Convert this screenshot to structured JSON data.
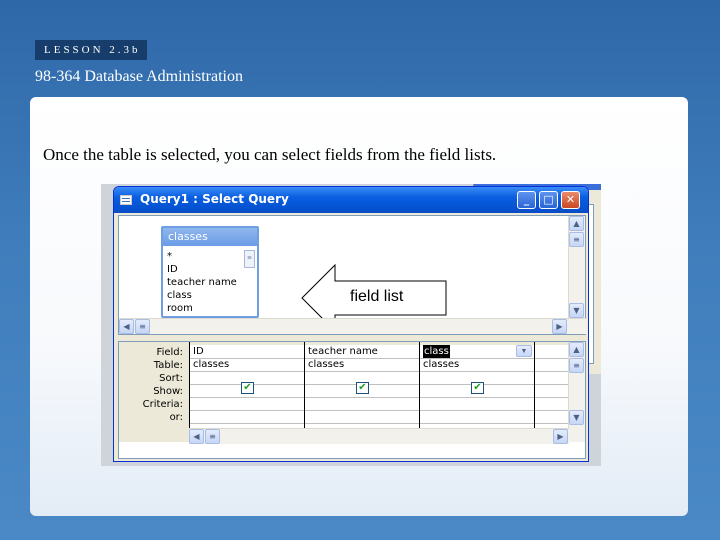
{
  "slide": {
    "lesson_tag": "LESSON 2.3b",
    "course_title": "98-364 Database Administration",
    "caption": "Once the table is selected, you can select fields from the field lists.",
    "callout": "field list"
  },
  "window": {
    "title": "Query1 : Select Query",
    "controls": {
      "minimize": "_",
      "maximize": "□",
      "close": "✕"
    }
  },
  "field_list": {
    "title": "classes",
    "items": [
      "*",
      "ID",
      "teacher name",
      "class",
      "room"
    ]
  },
  "design_grid": {
    "row_labels": [
      "Field:",
      "Table:",
      "Sort:",
      "Show:",
      "Criteria:",
      "or:"
    ],
    "columns": [
      {
        "field": "ID",
        "table": "classes",
        "show": true
      },
      {
        "field": "teacher name",
        "table": "classes",
        "show": true
      },
      {
        "field": "class",
        "table": "classes",
        "show": true,
        "selected": true
      }
    ]
  },
  "icons": {
    "arrow": "left-arrow-callout",
    "check": "✔",
    "scroll_up": "▲",
    "scroll_down": "▼",
    "scroll_left": "◀",
    "scroll_right": "▶",
    "dropdown": "▼",
    "grip": "≡"
  },
  "colors": {
    "titlebar": "#0453d2",
    "lesson_tag_bg": "#163d6b",
    "background": "#3f7dbc"
  }
}
